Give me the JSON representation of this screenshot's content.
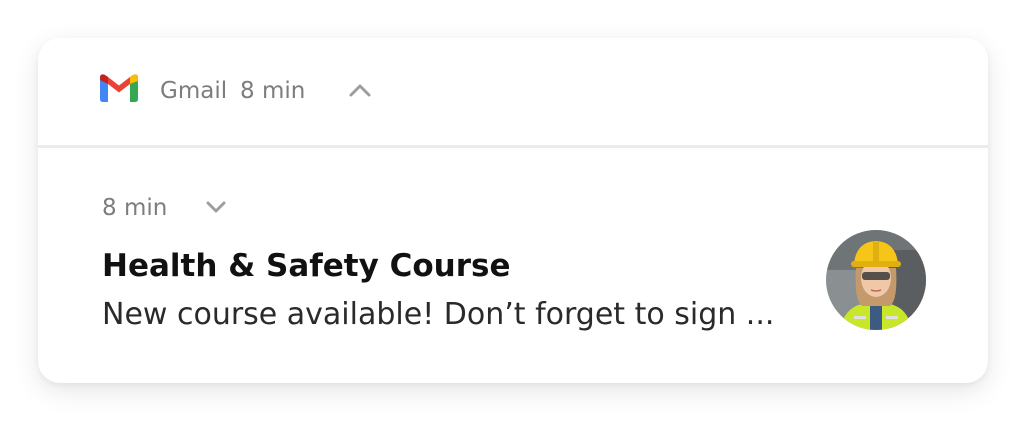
{
  "notification": {
    "app_name": "Gmail",
    "app_time": "8 min",
    "app_icon": "gmail-logo",
    "collapse_icon": "chevron-up-icon",
    "message": {
      "time": "8 min",
      "expand_icon": "chevron-down-icon",
      "title": "Health & Safety Course",
      "body": "New course available! Don’t forget to sign ...",
      "avatar": "person-in-hard-hat-avatar"
    }
  },
  "colors": {
    "gmail_red": "#EA4335",
    "gmail_blue": "#4285F4",
    "gmail_green": "#34A853",
    "gmail_yellow": "#FBBC04",
    "muted_text": "#7d7d7d",
    "hard_hat": "#f5c518",
    "hi_vis_vest": "#c8e62a"
  }
}
